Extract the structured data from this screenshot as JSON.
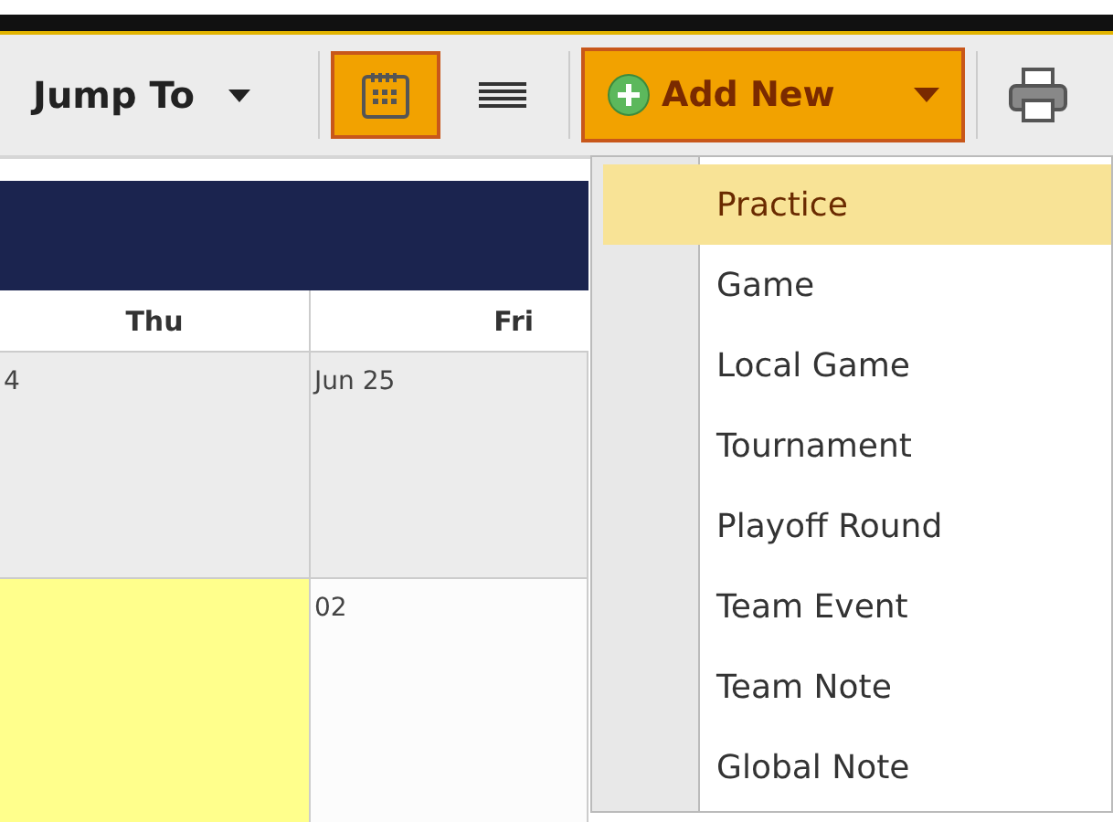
{
  "toolbar": {
    "jump_to": "Jump To",
    "views": [
      {
        "kind": "calendar",
        "selected": true
      },
      {
        "kind": "list",
        "selected": false
      }
    ],
    "add_new": "Add New"
  },
  "calendar": {
    "columns": [
      "Thu",
      "Fri"
    ],
    "rows": [
      {
        "cells": [
          {
            "date": "4",
            "highlighted": false
          },
          {
            "date": "Jun 25",
            "highlighted": false
          }
        ]
      },
      {
        "cells": [
          {
            "highlighted": true
          },
          {
            "date": "02",
            "highlighted": false
          }
        ]
      }
    ]
  },
  "add_menu": [
    {
      "label": "Practice",
      "selected": true
    },
    {
      "label": "Game",
      "selected": false
    },
    {
      "label": "Local Game",
      "selected": false
    },
    {
      "label": "Tournament",
      "selected": false
    },
    {
      "label": "Playoff Round",
      "selected": false
    },
    {
      "label": "Team Event",
      "selected": false
    },
    {
      "label": "Team Note",
      "selected": false
    },
    {
      "label": "Global Note",
      "selected": false
    }
  ]
}
